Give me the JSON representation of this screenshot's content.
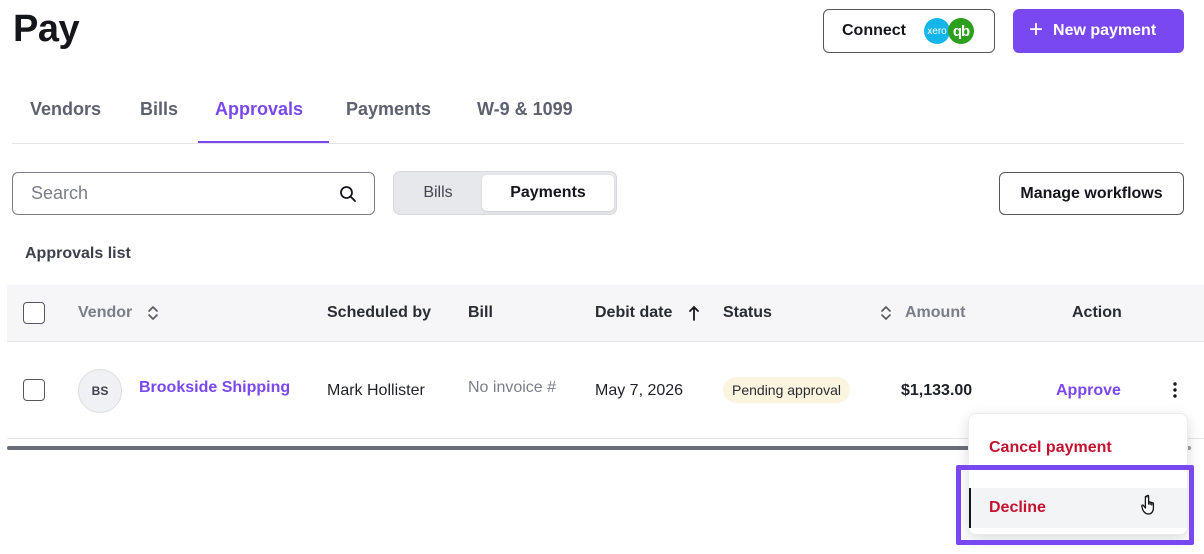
{
  "page": {
    "title": "Pay"
  },
  "header": {
    "connect_label": "Connect",
    "xero_logo_text": "xero",
    "qb_logo_text": "qb",
    "new_payment_label": "New payment"
  },
  "tabs": [
    {
      "label": "Vendors",
      "active": false
    },
    {
      "label": "Bills",
      "active": false
    },
    {
      "label": "Approvals",
      "active": true
    },
    {
      "label": "Payments",
      "active": false
    },
    {
      "label": "W-9 & 1099",
      "active": false
    }
  ],
  "toolbar": {
    "search_placeholder": "Search",
    "search_value": "",
    "segment": {
      "options": [
        "Bills",
        "Payments"
      ],
      "selected": "Payments"
    },
    "manage_workflows_label": "Manage workflows"
  },
  "list": {
    "title": "Approvals list",
    "columns": {
      "vendor": "Vendor",
      "scheduled_by": "Scheduled by",
      "bill": "Bill",
      "debit_date": "Debit date",
      "status": "Status",
      "amount": "Amount",
      "action": "Action"
    },
    "rows": [
      {
        "avatar_initials": "BS",
        "vendor": "Brookside Shipping",
        "scheduled_by": "Mark Hollister",
        "bill": "No invoice #",
        "debit_date": "May 7, 2026",
        "status": "Pending approval",
        "amount": "$1,133.00",
        "action": "Approve"
      }
    ]
  },
  "row_menu": {
    "items": [
      "Cancel payment",
      "Decline"
    ],
    "highlighted": "Decline"
  },
  "colors": {
    "accent": "#7a48f0",
    "danger": "#c41230",
    "status_badge_bg": "#fbf4de",
    "xero": "#13b5ea",
    "quickbooks": "#2ca01c"
  }
}
